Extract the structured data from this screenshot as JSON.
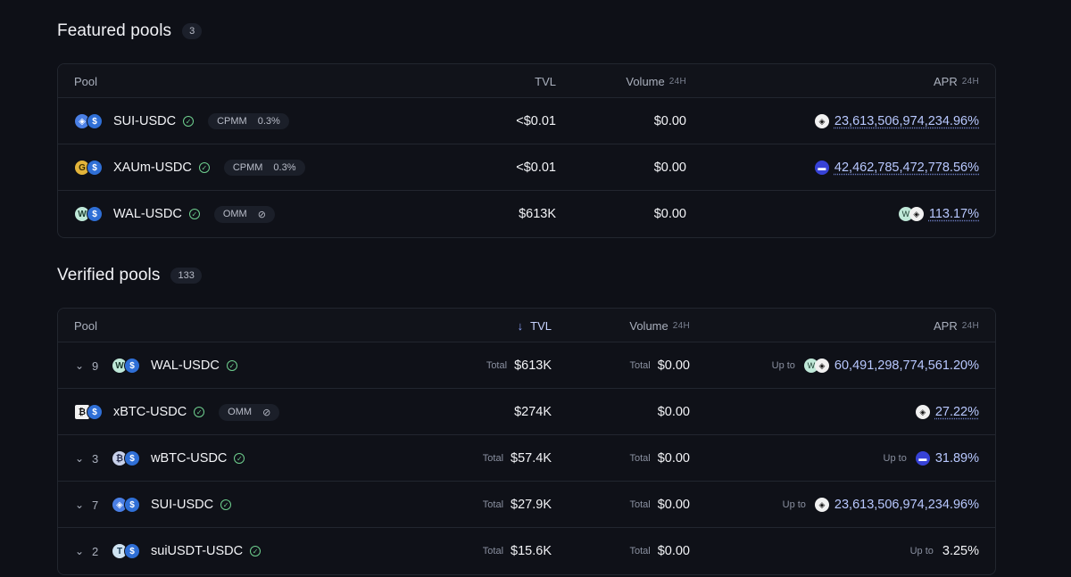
{
  "featured": {
    "title": "Featured pools",
    "count": "3",
    "headers": {
      "pool": "Pool",
      "tvl": "TVL",
      "volume": "Volume",
      "volume_sub": "24H",
      "apr": "APR",
      "apr_sub": "24H"
    },
    "rows": [
      {
        "name": "SUI-USDC",
        "tag1": "CPMM",
        "tag2": "0.3%",
        "tvl": "<$0.01",
        "volume": "$0.00",
        "apr": "23,613,506,974,234.96%"
      },
      {
        "name": "XAUm-USDC",
        "tag1": "CPMM",
        "tag2": "0.3%",
        "tvl": "<$0.01",
        "volume": "$0.00",
        "apr": "42,462,785,472,778.56%"
      },
      {
        "name": "WAL-USDC",
        "tag1": "OMM",
        "tag2": "⊘",
        "tvl": "$613K",
        "volume": "$0.00",
        "apr": "113.17%"
      }
    ]
  },
  "verified": {
    "title": "Verified pools",
    "count": "133",
    "headers": {
      "pool": "Pool",
      "tvl": "TVL",
      "volume": "Volume",
      "volume_sub": "24H",
      "apr": "APR",
      "apr_sub": "24H"
    },
    "total_label": "Total",
    "upto_label": "Up to",
    "rows": [
      {
        "count": "9",
        "name": "WAL-USDC",
        "tvl": "$613K",
        "volume": "$0.00",
        "apr": "60,491,298,774,561.20%"
      },
      {
        "name": "xBTC-USDC",
        "tag1": "OMM",
        "tag2": "⊘",
        "tvl": "$274K",
        "volume": "$0.00",
        "apr": "27.22%"
      },
      {
        "count": "3",
        "name": "wBTC-USDC",
        "tvl": "$57.4K",
        "volume": "$0.00",
        "apr": "31.89%"
      },
      {
        "count": "7",
        "name": "SUI-USDC",
        "tvl": "$27.9K",
        "volume": "$0.00",
        "apr": "23,613,506,974,234.96%"
      },
      {
        "count": "2",
        "name": "suiUSDT-USDC",
        "tvl": "$15.6K",
        "volume": "$0.00",
        "apr": "3.25%"
      }
    ]
  },
  "icons": {
    "sui": "sui-icon",
    "usdc": "usdc-icon",
    "xaum": "xaum-icon",
    "wal": "wal-icon",
    "xbtc": "xbtc-icon",
    "wbtc": "wbtc-icon",
    "usdt": "usdt-icon",
    "verified": "verified-check-icon",
    "chevron": "chevron-down-icon",
    "sort": "arrow-down-icon"
  },
  "colors": {
    "background": "#0e1017",
    "apr_accent": "#b8c8ff",
    "verified": "#6fd08f"
  }
}
